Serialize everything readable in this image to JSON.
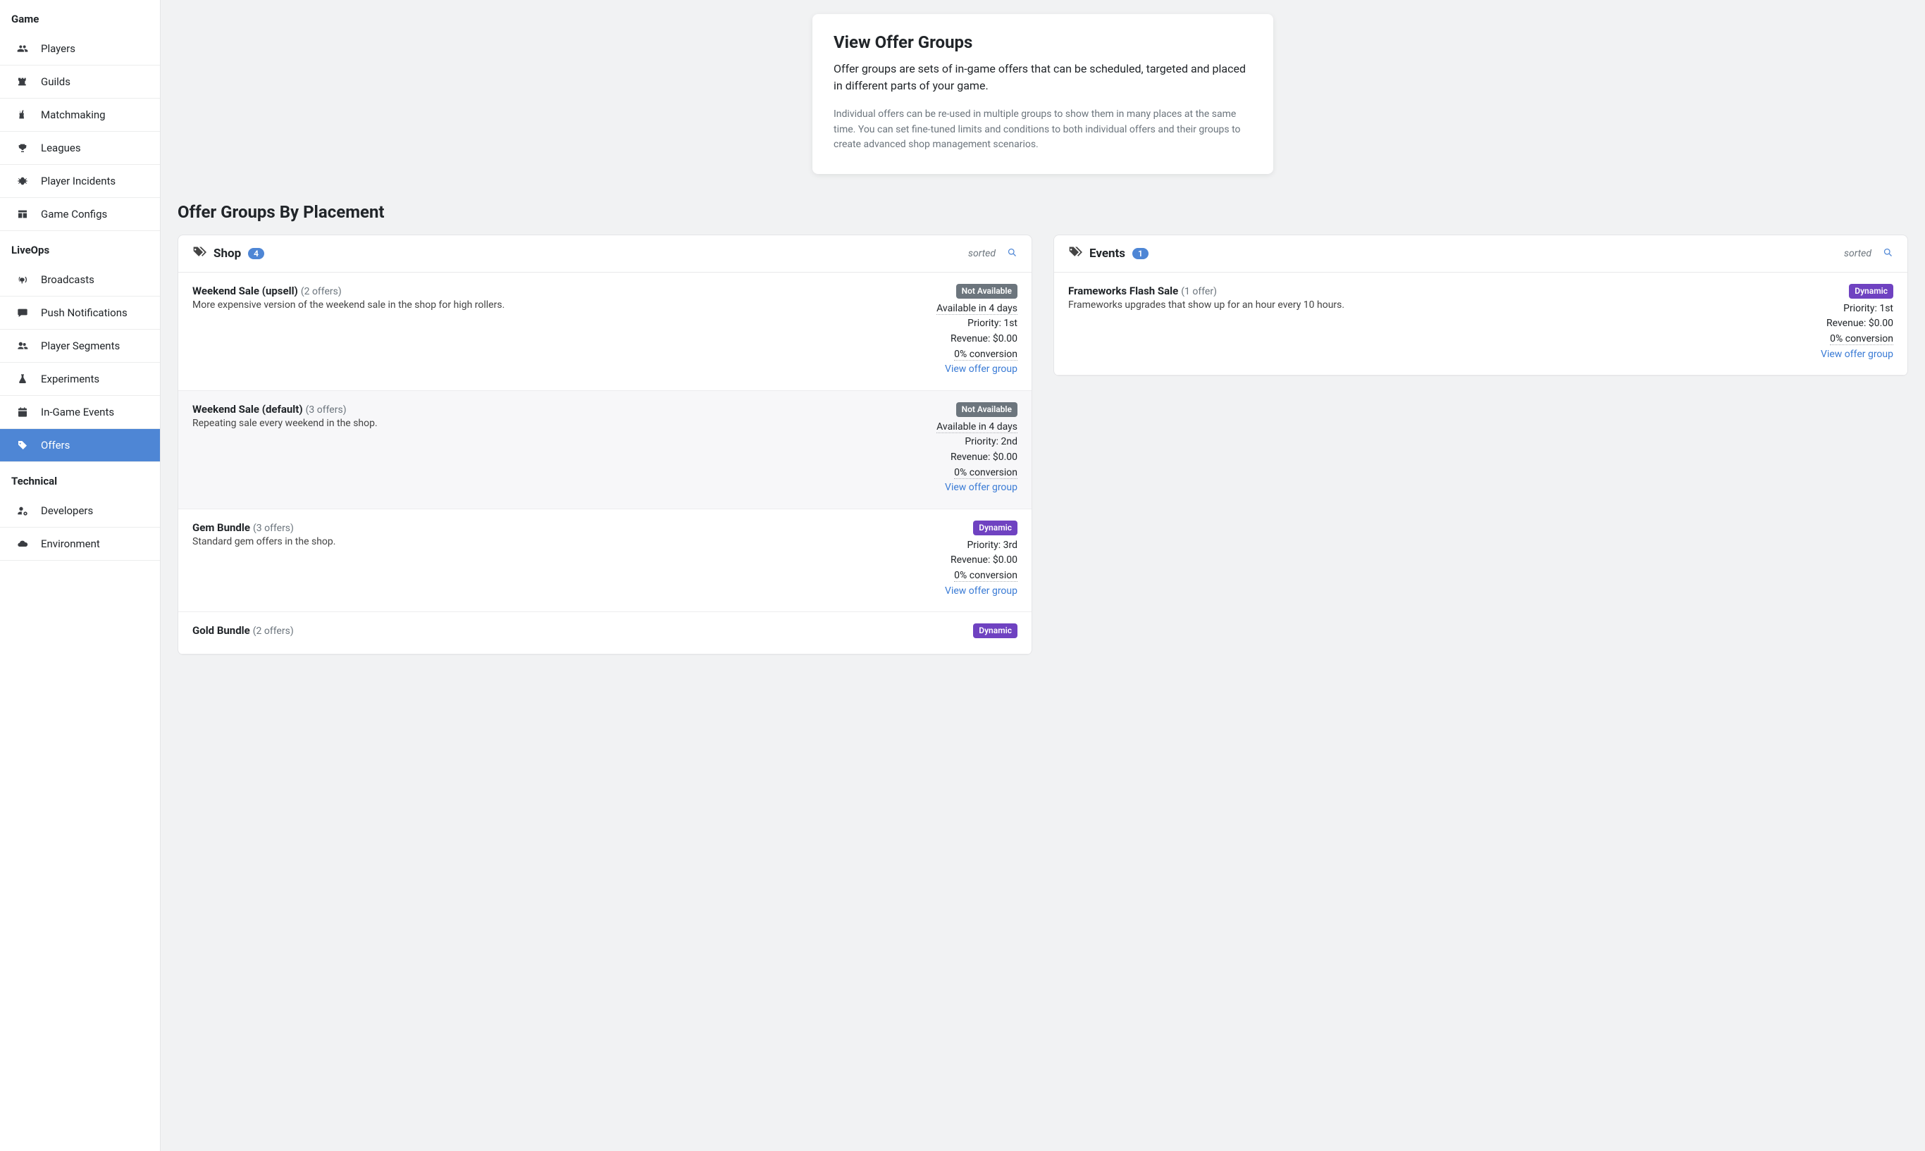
{
  "sidebar": {
    "sections": [
      {
        "header": "Game",
        "items": [
          {
            "label": "Players",
            "icon": "users"
          },
          {
            "label": "Guilds",
            "icon": "chess-rook"
          },
          {
            "label": "Matchmaking",
            "icon": "chess-board"
          },
          {
            "label": "Leagues",
            "icon": "trophy"
          },
          {
            "label": "Player Incidents",
            "icon": "bug"
          },
          {
            "label": "Game Configs",
            "icon": "table"
          }
        ]
      },
      {
        "header": "LiveOps",
        "items": [
          {
            "label": "Broadcasts",
            "icon": "broadcast"
          },
          {
            "label": "Push Notifications",
            "icon": "comment"
          },
          {
            "label": "Player Segments",
            "icon": "user-friends"
          },
          {
            "label": "Experiments",
            "icon": "flask"
          },
          {
            "label": "In-Game Events",
            "icon": "calendar"
          },
          {
            "label": "Offers",
            "icon": "tag",
            "active": true
          }
        ]
      },
      {
        "header": "Technical",
        "items": [
          {
            "label": "Developers",
            "icon": "user-cog"
          },
          {
            "label": "Environment",
            "icon": "cloud"
          }
        ]
      }
    ]
  },
  "intro": {
    "title": "View Offer Groups",
    "lead": "Offer groups are sets of in-game offers that can be scheduled, targeted and placed in different parts of your game.",
    "sub": "Individual offers can be re-used in multiple groups to show them in many places at the same time. You can set fine-tuned limits and conditions to both individual offers and their groups to create advanced shop management scenarios."
  },
  "section_title": "Offer Groups By Placement",
  "sorted_label": "sorted",
  "placements": [
    {
      "key": "shop",
      "title": "Shop",
      "count": "4",
      "offers": [
        {
          "name": "Weekend Sale (upsell)",
          "offers_count": "(2 offers)",
          "desc": "More expensive version of the weekend sale in the shop for high rollers.",
          "badge": {
            "text": "Not Available",
            "cls": "not-available"
          },
          "lines": [
            "Available in 4 days",
            "Priority: 1st",
            "Revenue: $0.00",
            "0% conversion"
          ],
          "dotted": [
            true,
            false,
            false,
            true
          ],
          "link": "View offer group"
        },
        {
          "name": "Weekend Sale (default)",
          "offers_count": "(3 offers)",
          "desc": "Repeating sale every weekend in the shop.",
          "badge": {
            "text": "Not Available",
            "cls": "not-available"
          },
          "lines": [
            "Available in 4 days",
            "Priority: 2nd",
            "Revenue: $0.00",
            "0% conversion"
          ],
          "dotted": [
            true,
            false,
            false,
            true
          ],
          "link": "View offer group",
          "hover": true
        },
        {
          "name": "Gem Bundle",
          "offers_count": "(3 offers)",
          "desc": "Standard gem offers in the shop.",
          "badge": {
            "text": "Dynamic",
            "cls": "dynamic"
          },
          "lines": [
            "Priority: 3rd",
            "Revenue: $0.00",
            "0% conversion"
          ],
          "dotted": [
            false,
            false,
            true
          ],
          "link": "View offer group"
        },
        {
          "name": "Gold Bundle",
          "offers_count": "(2 offers)",
          "desc": "",
          "badge": {
            "text": "Dynamic",
            "cls": "dynamic"
          },
          "lines": [],
          "dotted": [],
          "link": "",
          "partial": true
        }
      ]
    },
    {
      "key": "events",
      "title": "Events",
      "count": "1",
      "offers": [
        {
          "name": "Frameworks Flash Sale",
          "offers_count": "(1 offer)",
          "desc": "Frameworks upgrades that show up for an hour every 10 hours.",
          "badge": {
            "text": "Dynamic",
            "cls": "dynamic"
          },
          "lines": [
            "Priority: 1st",
            "Revenue: $0.00",
            "0% conversion"
          ],
          "dotted": [
            false,
            false,
            true
          ],
          "link": "View offer group"
        }
      ]
    }
  ]
}
